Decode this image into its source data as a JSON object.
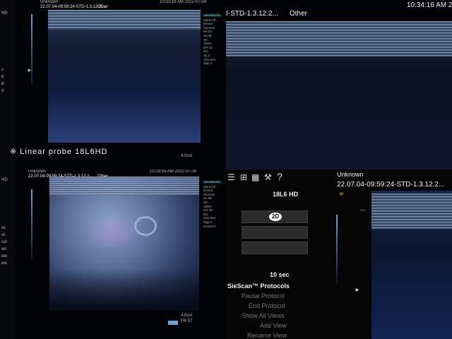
{
  "q1": {
    "header_left": "Unknown",
    "header_id": "22.07.04-09:59:24-STD-1.3.12.2....",
    "header_mode": "Other",
    "header_time": "10:33:18 AM 2022-07-04",
    "probe_caption": "※ Linear probe 18L6HD",
    "depth": "4.0cm",
    "params": [
      "SIEMENS",
      "18L6 HD",
      "Breast",
      "General",
      "90 fps",
      "34 dB",
      "2D",
      "100%",
      "DR 60",
      "B/2",
      "Sp 2",
      "SieClear",
      "Map A"
    ],
    "left_labels": [
      "HD",
      "s",
      "d",
      "d",
      "d",
      "d",
      "d"
    ]
  },
  "q2": {
    "header_id": "I-STD-1.3.12.2...",
    "header_mode": "Other",
    "header_time": "10:34:16 AM 2"
  },
  "q3": {
    "header_left": "Unknown",
    "header_id": "22.07.04-09:59:24-STD-1.3.12.2...",
    "header_mode": "Other",
    "header_time": "10:33:55 AM 2022-07-04",
    "depth": "4.0cm",
    "fr": "FR 57",
    "params": [
      "SIEMENS",
      "18L6 HD",
      "Breast",
      "General",
      "31 dB",
      "2D",
      "100%",
      "DR 60",
      "B/2",
      "SieClear",
      "Map A",
      "HarmCD"
    ],
    "left_labels": [
      "HD",
      "",
      "",
      "ec",
      "ol",
      "col",
      "ws",
      "ew",
      "ew"
    ]
  },
  "q4": {
    "toolbar_icons": [
      "list-icon",
      "tree-icon",
      "grid-icon",
      "wrench-icon",
      "help-icon"
    ],
    "help_glyph": "?",
    "probe_name": "18L6 HD",
    "mode_2d": "2D",
    "duration": "10 sec",
    "protocols_title": "SieScan™ Protocols",
    "menu_items": [
      "Pause Protocol",
      "End Protocol",
      "Show All Views",
      "Add View",
      "Rename View"
    ],
    "header_left": "Unknown",
    "header_id": "22.07.04-09:59:24-STD-1.3.12.2...",
    "accent": "#e6b020"
  }
}
